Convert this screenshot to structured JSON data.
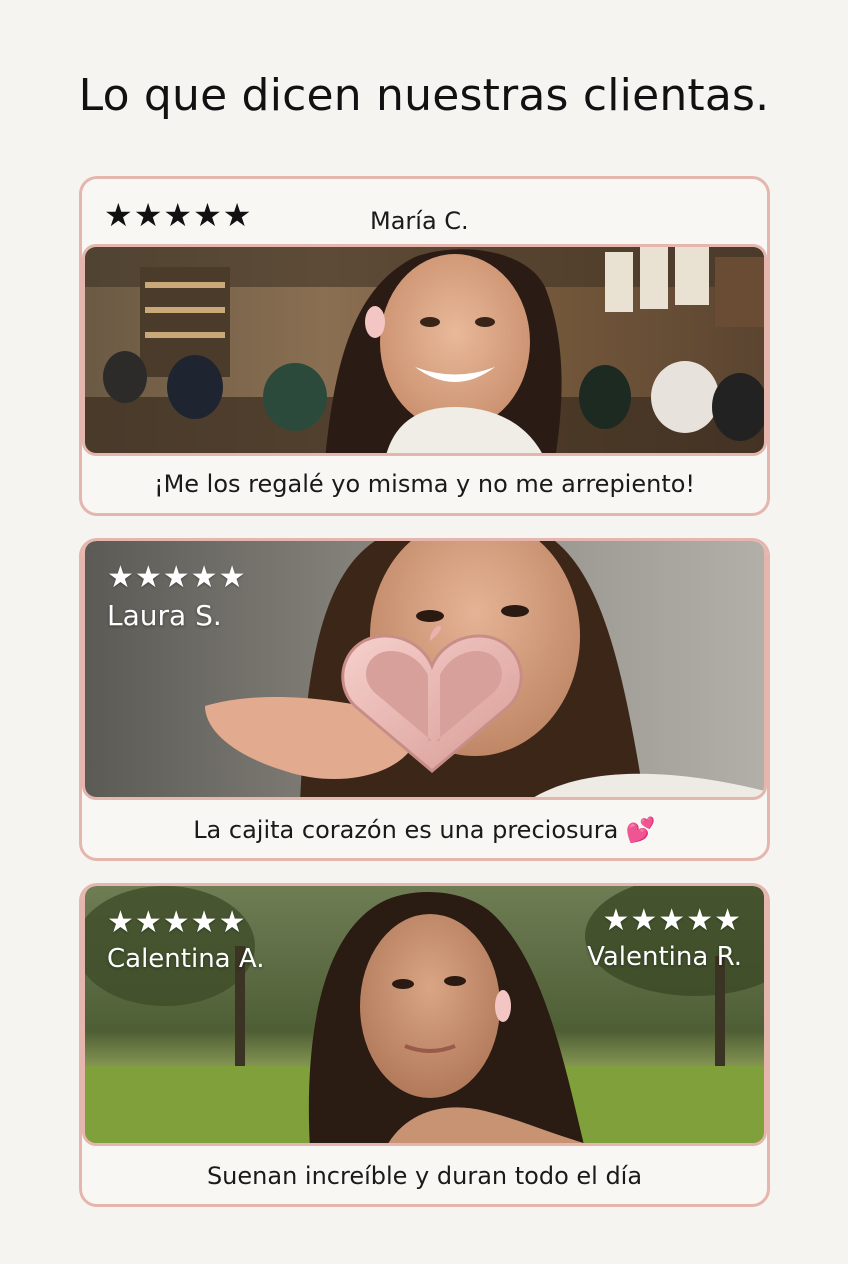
{
  "heading": "Lo que dicen nuestras clientas.",
  "reviews": [
    {
      "stars": "★★★★★",
      "name": "María C.",
      "quote": "¡Me los regalé yo misma y no me arrepiento!"
    },
    {
      "stars": "★★★★★",
      "name": "Laura S.",
      "quote": "La cajita corazón es una preciosura 💕"
    },
    {
      "stars_left": "★★★★★",
      "name_left": "Calentina A.",
      "stars_right": "★★★★★",
      "name_right": "Valentina R.",
      "quote": "Suenan increíble y duran todo el día"
    }
  ],
  "colors": {
    "card_border": "#e5b6ad",
    "page_background": "#f5f4f0",
    "product_pink": "#f3c6c4"
  }
}
